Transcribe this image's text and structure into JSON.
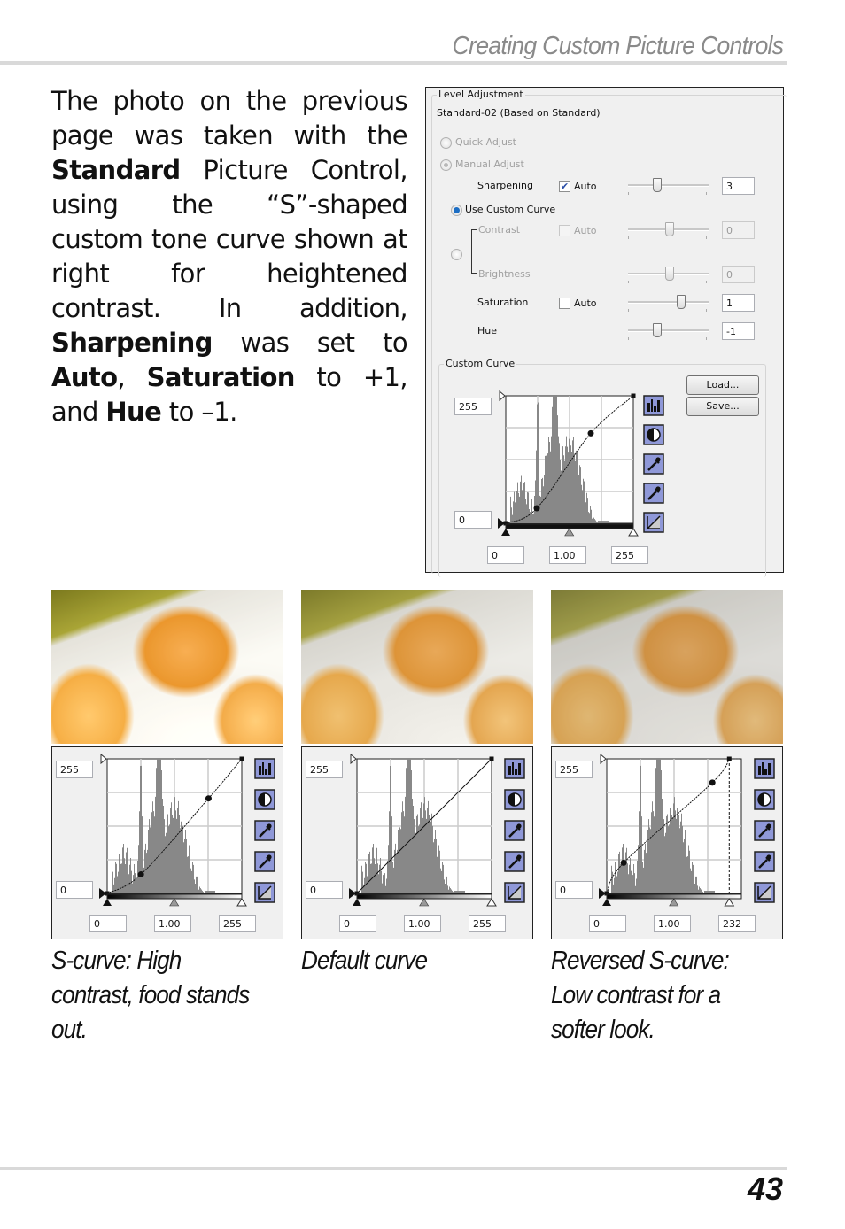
{
  "header": {
    "running_head": "Creating Custom Picture Controls"
  },
  "body": {
    "p1": "The photo on the previous page was taken with the ",
    "b1": "Standard",
    "p2": " Picture Control, using the “S”-shaped custom tone curve shown at right for heightened contrast. In addition, ",
    "b2": "Sharpening",
    "p3": " was set to ",
    "b3": "Auto",
    "p4": ", ",
    "b4": "Saturation",
    "p5": " to +1, and ",
    "b5": "Hue",
    "p6": " to –1."
  },
  "dialog": {
    "group_title": "Level Adjustment",
    "profile_name": "Standard-02 (Based on Standard)",
    "quick_adjust": "Quick Adjust",
    "manual_adjust": "Manual Adjust",
    "use_custom_curve": "Use Custom Curve",
    "auto_label": "Auto",
    "rows": {
      "sharpening": {
        "label": "Sharpening",
        "auto": true,
        "value": "3",
        "level": 0.33,
        "enabled": true
      },
      "contrast": {
        "label": "Contrast",
        "auto": false,
        "value": "0",
        "level": 0.5,
        "enabled": false
      },
      "brightness": {
        "label": "Brightness",
        "value": "0",
        "level": 0.5,
        "enabled": false
      },
      "saturation": {
        "label": "Saturation",
        "auto": false,
        "value": "1",
        "level": 0.65,
        "enabled": true
      },
      "hue": {
        "label": "Hue",
        "value": "-1",
        "level": 0.33,
        "enabled": true
      }
    },
    "custom_curve_title": "Custom Curve",
    "load_label": "Load...",
    "save_label": "Save...",
    "output_max": "255",
    "output_min": "0",
    "input_black": "0",
    "gamma": "1.00",
    "input_white": "255",
    "tool_icons": [
      "histogram-icon",
      "contrast-icon",
      "eyedropper-icon",
      "eyedropper-icon",
      "linear-curve-icon"
    ]
  },
  "examples": [
    {
      "name": "s-curve",
      "caption": "S-curve: High contrast, food stands out.",
      "output_max": "255",
      "output_min": "0",
      "input_black": "0",
      "gamma": "1.00",
      "input_white": "255",
      "points": [
        [
          0,
          0
        ],
        [
          64,
          36
        ],
        [
          192,
          180
        ],
        [
          255,
          255
        ]
      ],
      "white_point": 255
    },
    {
      "name": "default-curve",
      "caption": "Default curve",
      "output_max": "255",
      "output_min": "0",
      "input_black": "0",
      "gamma": "1.00",
      "input_white": "255",
      "points": [
        [
          0,
          0
        ],
        [
          255,
          255
        ]
      ],
      "white_point": 255
    },
    {
      "name": "reversed-s-curve",
      "caption": "Reversed S-curve: Low contrast for a softer look.",
      "output_max": "255",
      "output_min": "0",
      "input_black": "0",
      "gamma": "1.00",
      "input_white": "232",
      "points": [
        [
          0,
          0
        ],
        [
          32,
          58
        ],
        [
          200,
          210
        ],
        [
          232,
          255
        ]
      ],
      "white_point": 232
    }
  ],
  "main_curve": {
    "points": [
      [
        0,
        0
      ],
      [
        62,
        30
      ],
      [
        170,
        180
      ],
      [
        255,
        255
      ]
    ]
  },
  "footer": {
    "page_number": "43"
  },
  "colors": {
    "tool_button": "#8f98d8",
    "histogram": "#888888",
    "grid": "#cccccc"
  }
}
